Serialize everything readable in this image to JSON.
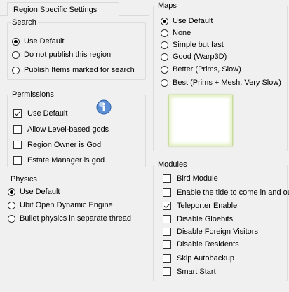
{
  "tab": {
    "label": "Region Specific Settings"
  },
  "search": {
    "title": "Search",
    "options": [
      {
        "label": "Use Default",
        "checked": true
      },
      {
        "label": "Do not publish this region",
        "checked": false
      },
      {
        "label": "Publish Items marked for search",
        "checked": false
      }
    ]
  },
  "permissions": {
    "title": "Permissions",
    "info_icon": "info-icon",
    "options": [
      {
        "label": "Use Default",
        "checked": true
      },
      {
        "label": "Allow Level-based gods",
        "checked": false
      },
      {
        "label": "Region Owner is God",
        "checked": false
      },
      {
        "label": "Estate Manager is god",
        "checked": false
      }
    ]
  },
  "physics": {
    "title": "Physics",
    "options": [
      {
        "label": "Use Default",
        "checked": true
      },
      {
        "label": "Ubit Open Dynamic Engine",
        "checked": false
      },
      {
        "label": "Bullet physics in separate thread",
        "checked": false
      }
    ]
  },
  "maps": {
    "title": "Maps",
    "options": [
      {
        "label": "Use Default",
        "checked": true
      },
      {
        "label": "None",
        "checked": false
      },
      {
        "label": "Simple but fast",
        "checked": false
      },
      {
        "label": "Good (Warp3D)",
        "checked": false
      },
      {
        "label": "Better (Prims, Slow)",
        "checked": false
      },
      {
        "label": "Best (Prims + Mesh, Very Slow)",
        "checked": false
      }
    ]
  },
  "modules": {
    "title": "Modules",
    "options": [
      {
        "label": "Bird Module",
        "checked": false
      },
      {
        "label": "Enable the tide to come in and out?",
        "checked": false
      },
      {
        "label": "Teleporter Enable",
        "checked": true
      },
      {
        "label": "Disable Gloebits",
        "checked": false
      },
      {
        "label": "Disable Foreign Visitors",
        "checked": false
      },
      {
        "label": "Disable Residents",
        "checked": false
      },
      {
        "label": "Skip Autobackup",
        "checked": false
      },
      {
        "label": "Smart Start",
        "checked": false
      }
    ]
  }
}
